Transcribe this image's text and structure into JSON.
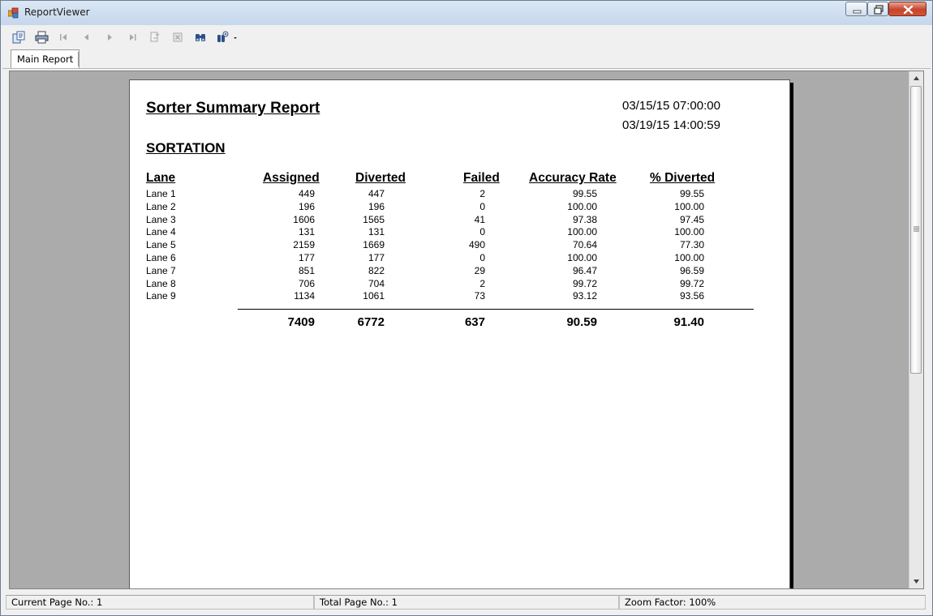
{
  "window": {
    "title": "ReportViewer"
  },
  "tabs": [
    {
      "label": "Main Report"
    }
  ],
  "toolbar": {
    "icons": [
      "export-icon",
      "print-icon",
      "first-page-icon",
      "previous-page-icon",
      "next-page-icon",
      "last-page-icon",
      "goto-parent-icon",
      "stop-icon",
      "find-icon",
      "zoom-icon"
    ]
  },
  "report": {
    "title": "Sorter Summary Report",
    "date_start": "03/15/15 07:00:00",
    "date_end": "03/19/15 14:00:59",
    "section": "SORTATION",
    "columns": [
      "Lane",
      "Assigned",
      "Diverted",
      "Failed",
      "Accuracy Rate",
      "% Diverted"
    ],
    "rows": [
      [
        "Lane 1",
        "449",
        "447",
        "2",
        "99.55",
        "99.55"
      ],
      [
        "Lane 2",
        "196",
        "196",
        "0",
        "100.00",
        "100.00"
      ],
      [
        "Lane 3",
        "1606",
        "1565",
        "41",
        "97.38",
        "97.45"
      ],
      [
        "Lane 4",
        "131",
        "131",
        "0",
        "100.00",
        "100.00"
      ],
      [
        "Lane 5",
        "2159",
        "1669",
        "490",
        "70.64",
        "77.30"
      ],
      [
        "Lane 6",
        "177",
        "177",
        "0",
        "100.00",
        "100.00"
      ],
      [
        "Lane 7",
        "851",
        "822",
        "29",
        "96.47",
        "96.59"
      ],
      [
        "Lane 8",
        "706",
        "704",
        "2",
        "99.72",
        "99.72"
      ],
      [
        "Lane 9",
        "1134",
        "1061",
        "73",
        "93.12",
        "93.56"
      ]
    ],
    "totals": [
      "7409",
      "6772",
      "637",
      "90.59",
      "91.40"
    ]
  },
  "status": {
    "current_page": "Current Page No.: 1",
    "total_page": "Total Page No.: 1",
    "zoom": "Zoom Factor: 100%"
  }
}
